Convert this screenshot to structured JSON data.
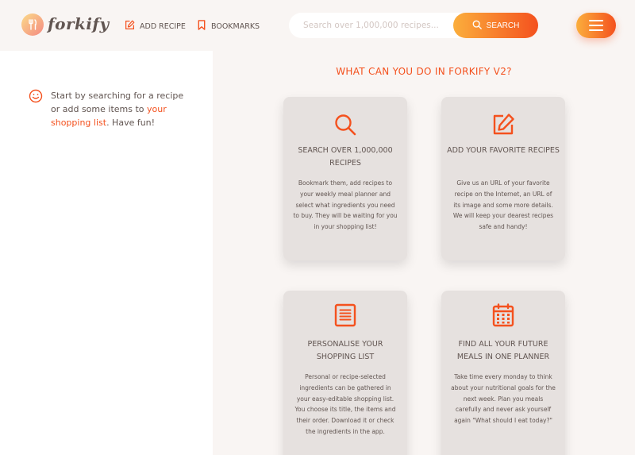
{
  "header": {
    "logo_text": "forkify",
    "add_recipe_label": "ADD RECIPE",
    "bookmarks_label": "BOOKMARKS",
    "search_placeholder": "Search over 1,000,000 recipes...",
    "search_button_label": "SEARCH"
  },
  "sidebar": {
    "message_prefix": "Start by searching for a recipe or add some items to ",
    "message_link": "your shopping list",
    "message_suffix": ". Have fun!"
  },
  "main": {
    "title": "WHAT CAN YOU DO IN FORKIFY V2?",
    "cards": [
      {
        "icon": "search-icon",
        "title": "SEARCH OVER 1,000,000 RECIPES",
        "text": "Bookmark them, add recipes to your weekly meal planner and select what ingredients you need to buy. They will be waiting for you in your shopping list!"
      },
      {
        "icon": "edit-icon",
        "title": "ADD YOUR FAVORITE RECIPES",
        "text": "Give us an URL of your favorite recipe on the Internet, an URL of its image and some more details. We will keep your dearest recipes safe and handy!"
      },
      {
        "icon": "list-icon",
        "title": "PERSONALISE YOUR SHOPPING LIST",
        "text": "Personal or recipe-selected ingredients can be gathered in your easy-editable shopping list. You choose its title, the items and their order. Download it or check the ingredients in the app."
      },
      {
        "icon": "calendar-icon",
        "title": "FIND ALL YOUR FUTURE MEALS IN ONE PLANNER",
        "text": "Take time every monday to think about your nutritional goals for the next week. Plan you meals carefully and never ask yourself again \"What should I eat today?\""
      }
    ]
  },
  "colors": {
    "accent": "#f4511e",
    "gradient_start": "#fbae3c",
    "background": "#f9f5f3",
    "card": "#e6e1df",
    "text": "#615551"
  }
}
